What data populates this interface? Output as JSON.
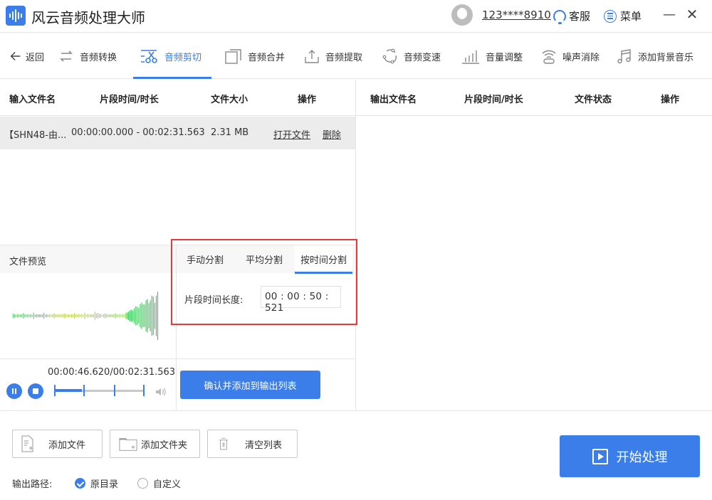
{
  "app": {
    "title": "风云音频处理大师",
    "accent_color": "#3b7de9",
    "highlight_color": "#e8383b"
  },
  "header": {
    "user_name": "123****8910",
    "service_label": "客服",
    "menu_label": "菜单",
    "minimize_glyph": "—",
    "close_glyph": "✕"
  },
  "toolbar": {
    "back_label": "返回",
    "tools": [
      {
        "label": "音频转换",
        "icon": "convert-icon"
      },
      {
        "label": "音频剪切",
        "icon": "scissors-icon",
        "active": true
      },
      {
        "label": "音频合并",
        "icon": "merge-icon"
      },
      {
        "label": "音频提取",
        "icon": "extract-icon"
      },
      {
        "label": "音频变速",
        "icon": "speed-icon"
      },
      {
        "label": "音量调整",
        "icon": "volume-bars-icon"
      },
      {
        "label": "噪声消除",
        "icon": "noise-icon"
      },
      {
        "label": "添加背景音乐",
        "icon": "music-icon"
      }
    ]
  },
  "input_table": {
    "headers": [
      "输入文件名",
      "片段时间/时长",
      "文件大小",
      "操作"
    ],
    "rows": [
      {
        "name": "【SHN48-由...",
        "segment": "00:00:00.000 - 00:02:31.563",
        "size": "2.31 MB",
        "open_label": "打开文件",
        "delete_label": "删除"
      }
    ]
  },
  "output_table": {
    "headers": [
      "输出文件名",
      "片段时间/时长",
      "文件状态",
      "操作"
    ],
    "rows": []
  },
  "preview": {
    "title": "文件预览",
    "current_time": "00:00:46.620",
    "total_time": "00:02:31.563",
    "time_display": "00:00:46.620/00:02:31.563",
    "progress": 0.31
  },
  "split": {
    "tabs": [
      "手动分割",
      "平均分割",
      "按时间分割"
    ],
    "active_tab": 2,
    "segment_label": "片段时间长度:",
    "segment_value": "00 : 00 : 50 : 521",
    "confirm_label": "确认并添加到输出列表"
  },
  "bottom": {
    "add_file_label": "添加文件",
    "add_folder_label": "添加文件夹",
    "clear_label": "清空列表",
    "output_path_label": "输出路径:",
    "options": [
      {
        "label": "原目录",
        "selected": true
      },
      {
        "label": "自定义",
        "selected": false
      }
    ],
    "start_label": "开始处理"
  }
}
